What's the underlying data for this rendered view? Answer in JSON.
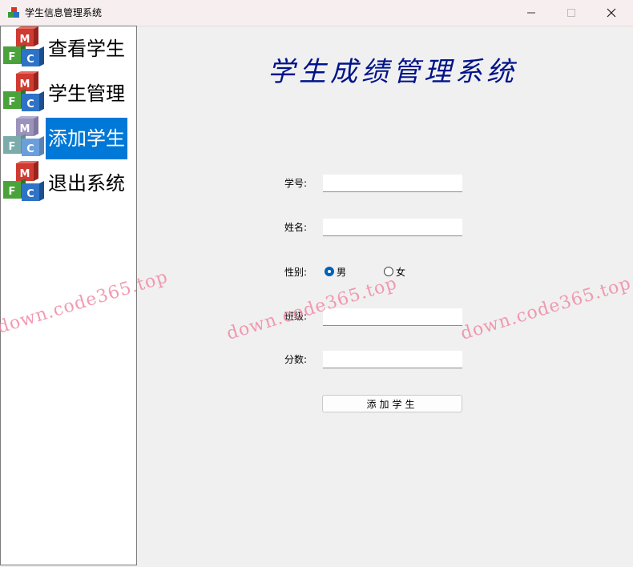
{
  "window": {
    "title": "学生信息管理系统",
    "icon": "app-cube-icon",
    "controls": [
      "minimize-icon",
      "maximize-icon",
      "close-icon"
    ]
  },
  "sidebar": {
    "items": [
      {
        "label": "查看学生",
        "icon": "mfc-cube-icon",
        "selected": false
      },
      {
        "label": "学生管理",
        "icon": "mfc-cube-icon",
        "selected": false
      },
      {
        "label": "添加学生",
        "icon": "mfc-cube-icon",
        "selected": true
      },
      {
        "label": "退出系统",
        "icon": "mfc-cube-icon",
        "selected": false
      }
    ],
    "selected_color": "#0078d7"
  },
  "main": {
    "title": "学生成绩管理系统",
    "title_color": "#00138a",
    "form": {
      "student_id": {
        "label": "学号:",
        "value": ""
      },
      "name": {
        "label": "姓名:",
        "value": ""
      },
      "gender": {
        "label": "性别:",
        "options": [
          "男",
          "女"
        ],
        "selected": "男"
      },
      "class": {
        "label": "班级:",
        "value": ""
      },
      "score": {
        "label": "分数:",
        "value": ""
      },
      "submit_label": "添加学生"
    }
  },
  "watermark": {
    "text": "down.code365.top",
    "color": "#f08aa4"
  }
}
